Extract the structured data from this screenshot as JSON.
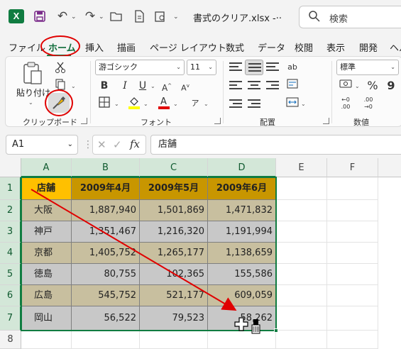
{
  "titlebar": {
    "app_logo": "X",
    "filename": "書式のクリア.xlsx  -··",
    "search_placeholder": "検索",
    "icons": [
      "save-icon",
      "undo-icon",
      "redo-icon",
      "open-folder-icon",
      "file-icon",
      "quick-access-menu-icon"
    ]
  },
  "menu": {
    "tabs": [
      "ファイル",
      "ホーム",
      "挿入",
      "描画",
      "ページ レイアウト",
      "数式",
      "データ",
      "校閲",
      "表示",
      "開発",
      "ヘル"
    ],
    "active": "ホーム"
  },
  "ribbon": {
    "clipboard": {
      "paste_label": "貼り付け",
      "group_label": "クリップボード"
    },
    "font": {
      "font_name": "游ゴシック",
      "font_size": "11",
      "bold": "B",
      "italic": "I",
      "underline": "U",
      "group_label": "フォント"
    },
    "alignment": {
      "group_label": "配置"
    },
    "number": {
      "format": "標準",
      "percent": "%",
      "comma": "9",
      "group_label": "数値"
    }
  },
  "formula_bar": {
    "name_box": "A1",
    "fx": "fx",
    "value": "店舗"
  },
  "sheet": {
    "columns": [
      "A",
      "B",
      "C",
      "D",
      "E",
      "F"
    ],
    "rows": [
      "1",
      "2",
      "3",
      "4",
      "5",
      "6",
      "7",
      "8"
    ],
    "header_row": [
      "店舗",
      "2009年4月",
      "2009年5月",
      "2009年6月"
    ],
    "data_rows": [
      [
        "大阪",
        "1,887,940",
        "1,501,869",
        "1,471,832"
      ],
      [
        "神戸",
        "1,351,467",
        "1,216,320",
        "1,191,994"
      ],
      [
        "京都",
        "1,405,752",
        "1,265,177",
        "1,138,659"
      ],
      [
        "徳島",
        "80,755",
        "102,365",
        "155,586"
      ],
      [
        "広島",
        "545,752",
        "521,177",
        "609,059"
      ],
      [
        "岡山",
        "56,522",
        "79,523",
        "58,262"
      ]
    ]
  },
  "colors": {
    "header_fill": "#c89600",
    "header_a1_fill": "#ffc000",
    "band_fill": "#c8bf9f",
    "plain_fill": "#c8c8c8",
    "accent": "#107c41",
    "annotation": "#e00000"
  }
}
